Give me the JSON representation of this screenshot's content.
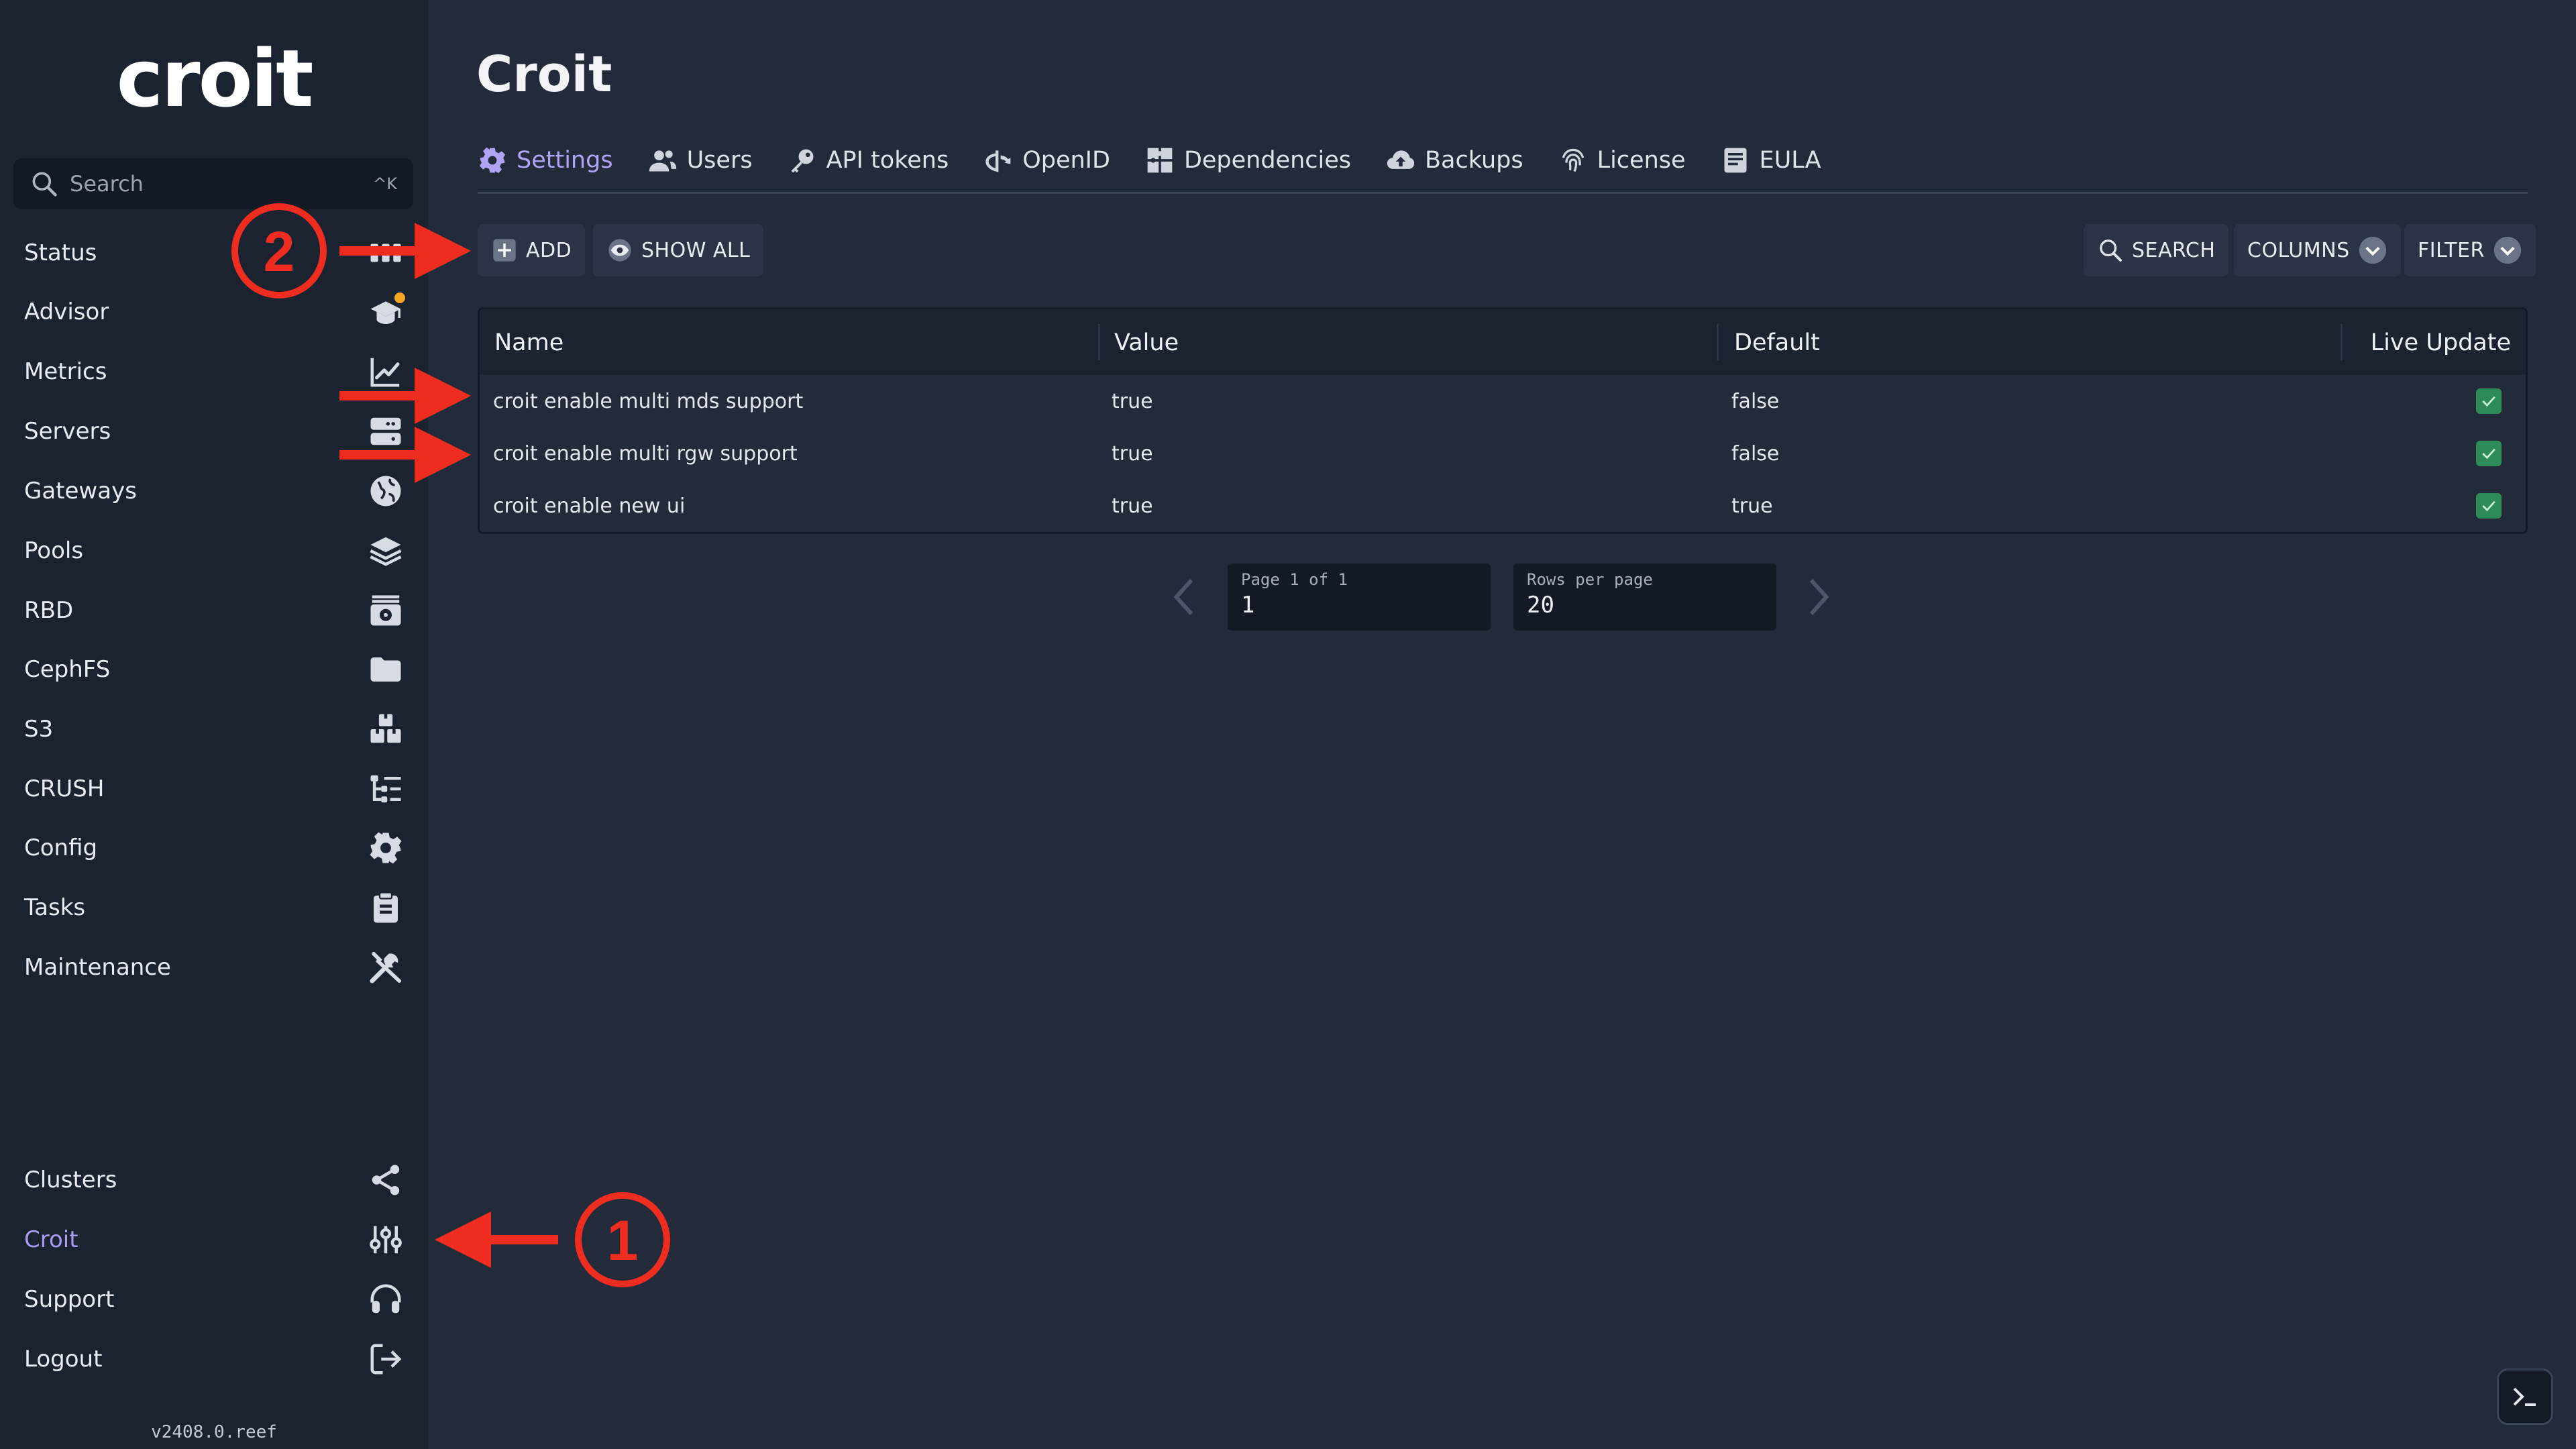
{
  "sidebar": {
    "logo": "croit",
    "search": {
      "placeholder": "Search",
      "shortcut": "^K",
      "icon": "search-icon"
    },
    "items": [
      {
        "label": "Status",
        "icon": "status-grid-icon"
      },
      {
        "label": "Advisor",
        "icon": "graduation-cap-icon",
        "badge_color": "#f5a623"
      },
      {
        "label": "Metrics",
        "icon": "line-chart-icon"
      },
      {
        "label": "Servers",
        "icon": "server-icon"
      },
      {
        "label": "Gateways",
        "icon": "globe-icon"
      },
      {
        "label": "Pools",
        "icon": "layers-icon"
      },
      {
        "label": "RBD",
        "icon": "disk-icon"
      },
      {
        "label": "CephFS",
        "icon": "folder-icon"
      },
      {
        "label": "S3",
        "icon": "boxes-icon"
      },
      {
        "label": "CRUSH",
        "icon": "tree-list-icon"
      },
      {
        "label": "Config",
        "icon": "gear-icon"
      },
      {
        "label": "Tasks",
        "icon": "clipboard-icon"
      },
      {
        "label": "Maintenance",
        "icon": "tools-icon"
      }
    ],
    "bottom_items": [
      {
        "label": "Clusters",
        "icon": "share-icon"
      },
      {
        "label": "Croit",
        "icon": "sliders-icon",
        "active": true
      },
      {
        "label": "Support",
        "icon": "headset-icon"
      },
      {
        "label": "Logout",
        "icon": "logout-icon"
      }
    ],
    "version": "v2408.0.reef"
  },
  "page": {
    "title": "Croit"
  },
  "tabs": [
    {
      "label": "Settings",
      "icon": "gear-icon",
      "active": true
    },
    {
      "label": "Users",
      "icon": "users-icon"
    },
    {
      "label": "API tokens",
      "icon": "key-icon"
    },
    {
      "label": "OpenID",
      "icon": "openid-icon"
    },
    {
      "label": "Dependencies",
      "icon": "puzzle-icon"
    },
    {
      "label": "Backups",
      "icon": "cloud-upload-icon"
    },
    {
      "label": "License",
      "icon": "fingerprint-icon"
    },
    {
      "label": "EULA",
      "icon": "document-icon"
    }
  ],
  "toolbar": {
    "add_label": "ADD",
    "show_all_label": "SHOW ALL",
    "search_label": "SEARCH",
    "columns_label": "COLUMNS",
    "filter_label": "FILTER"
  },
  "table": {
    "headers": {
      "name": "Name",
      "value": "Value",
      "default": "Default",
      "live_update": "Live Update"
    },
    "rows": [
      {
        "name": "croit enable multi mds support",
        "value": "true",
        "default": "false",
        "live_update": true
      },
      {
        "name": "croit enable multi rgw support",
        "value": "true",
        "default": "false",
        "live_update": true
      },
      {
        "name": "croit enable new ui",
        "value": "true",
        "default": "true",
        "live_update": true
      }
    ]
  },
  "pagination": {
    "page_caption": "Page 1 of 1",
    "page_value": "1",
    "rows_caption": "Rows per page",
    "rows_value": "20"
  },
  "annotations": {
    "one": "1",
    "two": "2",
    "color": "#ee2c1f"
  },
  "colors": {
    "accent": "#a99cf2",
    "check": "#2e8b57",
    "sidebar_bg": "#1b2230",
    "main_bg": "#232b3a"
  }
}
